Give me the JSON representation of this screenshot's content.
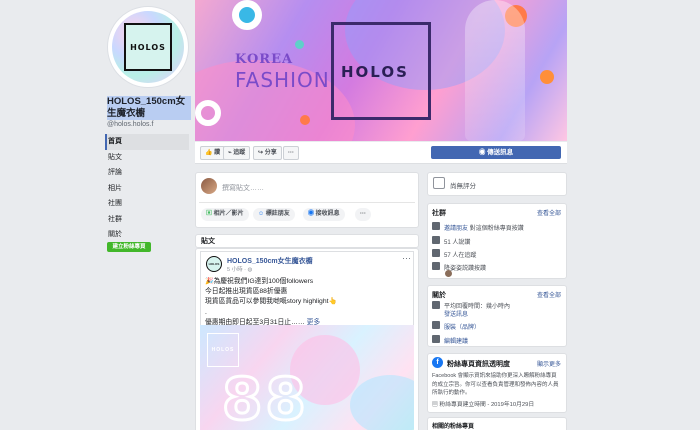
{
  "page": {
    "logo_text": "HOLOS",
    "name": "HOLOS_150cm女生魔衣櫥",
    "handle": "@holos.holos.f"
  },
  "nav": {
    "items": [
      "首頁",
      "貼文",
      "評論",
      "相片",
      "社團",
      "社群",
      "關於"
    ],
    "active_index": 0,
    "create_button": "建立粉絲專頁"
  },
  "cover": {
    "text_korea": "KOREA",
    "text_fashion": "FASHION",
    "logo": "HOLOS"
  },
  "actions": {
    "like": "讚",
    "follow": "追蹤",
    "share": "分享",
    "more": "···",
    "send_message": "傳送訊息"
  },
  "composer": {
    "placeholder": "撰寫貼文……",
    "photo_video": "相片／影片",
    "tag_friends": "標註朋友",
    "message": "接收訊息",
    "more": "···"
  },
  "posts": {
    "header": "貼文",
    "items": [
      {
        "author": "HOLOS_150cm女生魔衣櫥",
        "time": "5 小時 · ",
        "more": "···",
        "lines": [
          "🎉為慶祝我們IG達到100個followers",
          "今日起推出現貨區88折優惠",
          "現貨區貨品可以參閱我哋嘅story highlight👆",
          ".",
          "優惠期由即日起至3月31日止……"
        ],
        "see_more": "更多",
        "image_logo": "HOLOS",
        "image_big_text": "88"
      }
    ]
  },
  "sidebar": {
    "rating": "尚無評分",
    "community": {
      "title": "社群",
      "see_all": "查看全部",
      "invite_link": "邀請朋友",
      "invite_rest": "對這個粉絲專頁按讚",
      "likes": "51 人說讚",
      "follows": "57 人在追蹤",
      "checkins": "降姿姿説讚按讚"
    },
    "about": {
      "title": "關於",
      "see_all": "查看全部",
      "response": "平均回覆時間：幾小時內",
      "send_message": "發送訊息",
      "category": "服裝（品牌）",
      "suggest": "編輯建議"
    },
    "transparency": {
      "title": "粉絲專頁資訊透明度",
      "show_more": "顯示更多",
      "desc": "Facebook 會顯示資訊來協助你更深入瞭解粉絲專頁的成立宗旨。你可以查看負責管理和發佈內容的人員所執行的動作。",
      "created": "粉絲專頁建立時間 - 2019年10月29日"
    },
    "related": "相關的粉絲專頁"
  },
  "colors": {
    "brand_blue": "#4267b2",
    "link": "#385898",
    "green": "#42b72a",
    "bg": "#e9ebee"
  }
}
